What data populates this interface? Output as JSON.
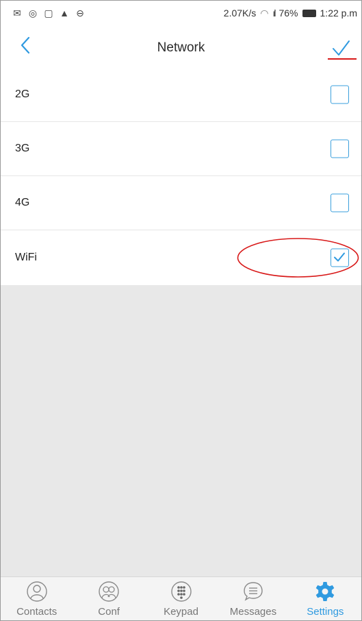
{
  "status_bar": {
    "speed": "2.07K/s",
    "battery": "76%",
    "time": "1:22 p.m"
  },
  "header": {
    "title": "Network"
  },
  "options": [
    {
      "label": "2G",
      "checked": false
    },
    {
      "label": "3G",
      "checked": false
    },
    {
      "label": "4G",
      "checked": false
    },
    {
      "label": "WiFi",
      "checked": true
    }
  ],
  "tabs": [
    {
      "label": "Contacts",
      "icon": "contacts-icon"
    },
    {
      "label": "Conf",
      "icon": "conference-icon"
    },
    {
      "label": "Keypad",
      "icon": "keypad-icon"
    },
    {
      "label": "Messages",
      "icon": "messages-icon"
    },
    {
      "label": "Settings",
      "icon": "settings-icon",
      "active": true
    }
  ],
  "colors": {
    "accent": "#2f9ae0",
    "annotation": "#d81818"
  }
}
